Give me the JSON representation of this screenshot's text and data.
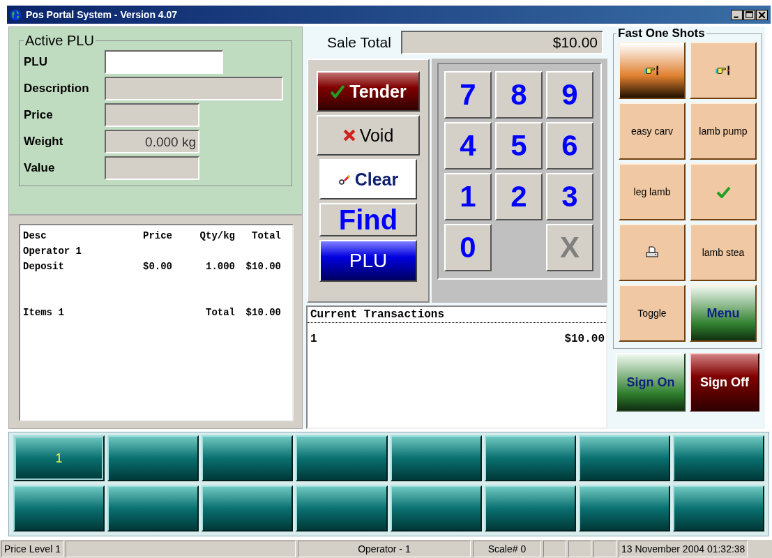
{
  "window": {
    "title": "Pos Portal  System - Version 4.07"
  },
  "active_plu": {
    "title": "Active PLU",
    "fields": [
      {
        "label": "PLU",
        "kind": "input"
      },
      {
        "label": "Description",
        "kind": "wide"
      },
      {
        "label": "Price",
        "kind": "readonly"
      },
      {
        "label": "Weight",
        "value": "0.000 kg",
        "kind": "readonly"
      },
      {
        "label": "Value",
        "kind": "readonly"
      }
    ]
  },
  "receipt": {
    "columns": [
      "Desc",
      "Price",
      "Qty/kg",
      "Total"
    ],
    "rows": [
      {
        "cells": [
          "Operator 1"
        ]
      },
      {
        "cells": [
          "Deposit",
          "$0.00",
          "1.000",
          "$10.00"
        ]
      },
      {
        "kind": "gap"
      },
      {
        "cells": [
          "Items 1",
          "",
          "Total",
          "$10.00"
        ]
      }
    ]
  },
  "sale_total": {
    "label": "Sale Total",
    "value": "$10.00"
  },
  "action_buttons": [
    {
      "label": "Tender",
      "kind": "tender"
    },
    {
      "label": "Void",
      "kind": "void"
    },
    {
      "label": "Clear",
      "kind": "clear"
    },
    {
      "label": "Find",
      "kind": "find"
    },
    {
      "label": "PLU",
      "kind": "plu"
    }
  ],
  "keypad": [
    {
      "label": "7",
      "kind": "digit"
    },
    {
      "label": "8",
      "kind": "digit"
    },
    {
      "label": "9",
      "kind": "digit"
    },
    {
      "label": "4",
      "kind": "digit"
    },
    {
      "label": "5",
      "kind": "digit"
    },
    {
      "label": "6",
      "kind": "digit"
    },
    {
      "label": "1",
      "kind": "digit"
    },
    {
      "label": "2",
      "kind": "digit"
    },
    {
      "label": "3",
      "kind": "digit"
    },
    {
      "label": "0",
      "kind": "digit"
    },
    {
      "kind": "blank"
    },
    {
      "label": "X",
      "kind": "cancel"
    }
  ],
  "transactions": {
    "title": "Current Transactions",
    "rows": [
      {
        "id": "1",
        "amount": "$10.00"
      }
    ]
  },
  "fast_one_shots": {
    "title": "Fast One Shots",
    "buttons": [
      {
        "kind": "hand",
        "highlighted": true
      },
      {
        "kind": "hand",
        "highlighted": false
      },
      {
        "kind": "text",
        "label": "easy carv",
        "highlighted": false
      },
      {
        "kind": "text",
        "label": "lamb pump",
        "highlighted": false
      },
      {
        "kind": "text",
        "label": "leg lamb",
        "highlighted": false
      },
      {
        "kind": "check",
        "highlighted": false
      },
      {
        "kind": "printer",
        "highlighted": false
      },
      {
        "kind": "text",
        "label": "lamb stea",
        "highlighted": false
      },
      {
        "kind": "text",
        "label": "Toggle",
        "highlighted": false
      },
      {
        "kind": "menu",
        "label": "Menu",
        "highlighted": false
      }
    ]
  },
  "sign_buttons": [
    {
      "label": "Sign On",
      "kind": "on"
    },
    {
      "label": "Sign Off",
      "kind": "off"
    }
  ],
  "preset_keys": [
    {
      "label": "1",
      "selected": true
    },
    {
      "selected": false
    },
    {
      "selected": false
    },
    {
      "selected": false
    },
    {
      "selected": false
    },
    {
      "selected": false
    },
    {
      "selected": false
    },
    {
      "selected": false
    },
    {
      "selected": false
    },
    {
      "selected": false
    },
    {
      "selected": false
    },
    {
      "selected": false
    },
    {
      "selected": false
    },
    {
      "selected": false
    },
    {
      "selected": false
    },
    {
      "selected": false
    }
  ],
  "status_bar": [
    {
      "text": "Price Level 1",
      "kind": "text"
    },
    {
      "kind": "empty"
    },
    {
      "text": "Operator - 1",
      "kind": "center"
    },
    {
      "text": "Scale# 0",
      "kind": "center"
    },
    {
      "kind": "small"
    },
    {
      "kind": "small"
    },
    {
      "kind": "small"
    },
    {
      "text": "13 November 2004 01:32:38",
      "kind": "text"
    }
  ]
}
